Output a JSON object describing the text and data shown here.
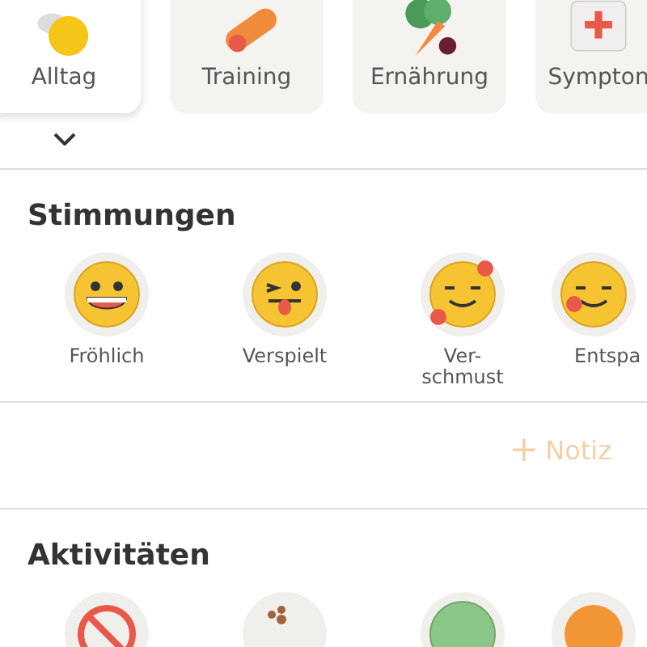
{
  "categories": [
    {
      "label": "Alltag",
      "kind": "daily",
      "selected": true
    },
    {
      "label": "Training",
      "kind": "training",
      "selected": false
    },
    {
      "label": "Ernährung",
      "kind": "food",
      "selected": false
    },
    {
      "label": "Sympton",
      "kind": "symptoms",
      "selected": false
    }
  ],
  "moods": {
    "title": "Stimmungen",
    "items": [
      {
        "label": "Fröhlich",
        "kind": "laugh"
      },
      {
        "label": "Verspielt",
        "kind": "wink"
      },
      {
        "label": "Ver-\nschmust",
        "kind": "hearts"
      },
      {
        "label": "Entspa",
        "kind": "relaxed"
      }
    ]
  },
  "note_button": {
    "icon": "+",
    "label": "Notiz"
  },
  "activities": {
    "title": "Aktivitäten",
    "items": [
      {
        "kind": "forbidden"
      },
      {
        "kind": "paw"
      },
      {
        "kind": "ball"
      },
      {
        "kind": "orange"
      }
    ]
  }
}
